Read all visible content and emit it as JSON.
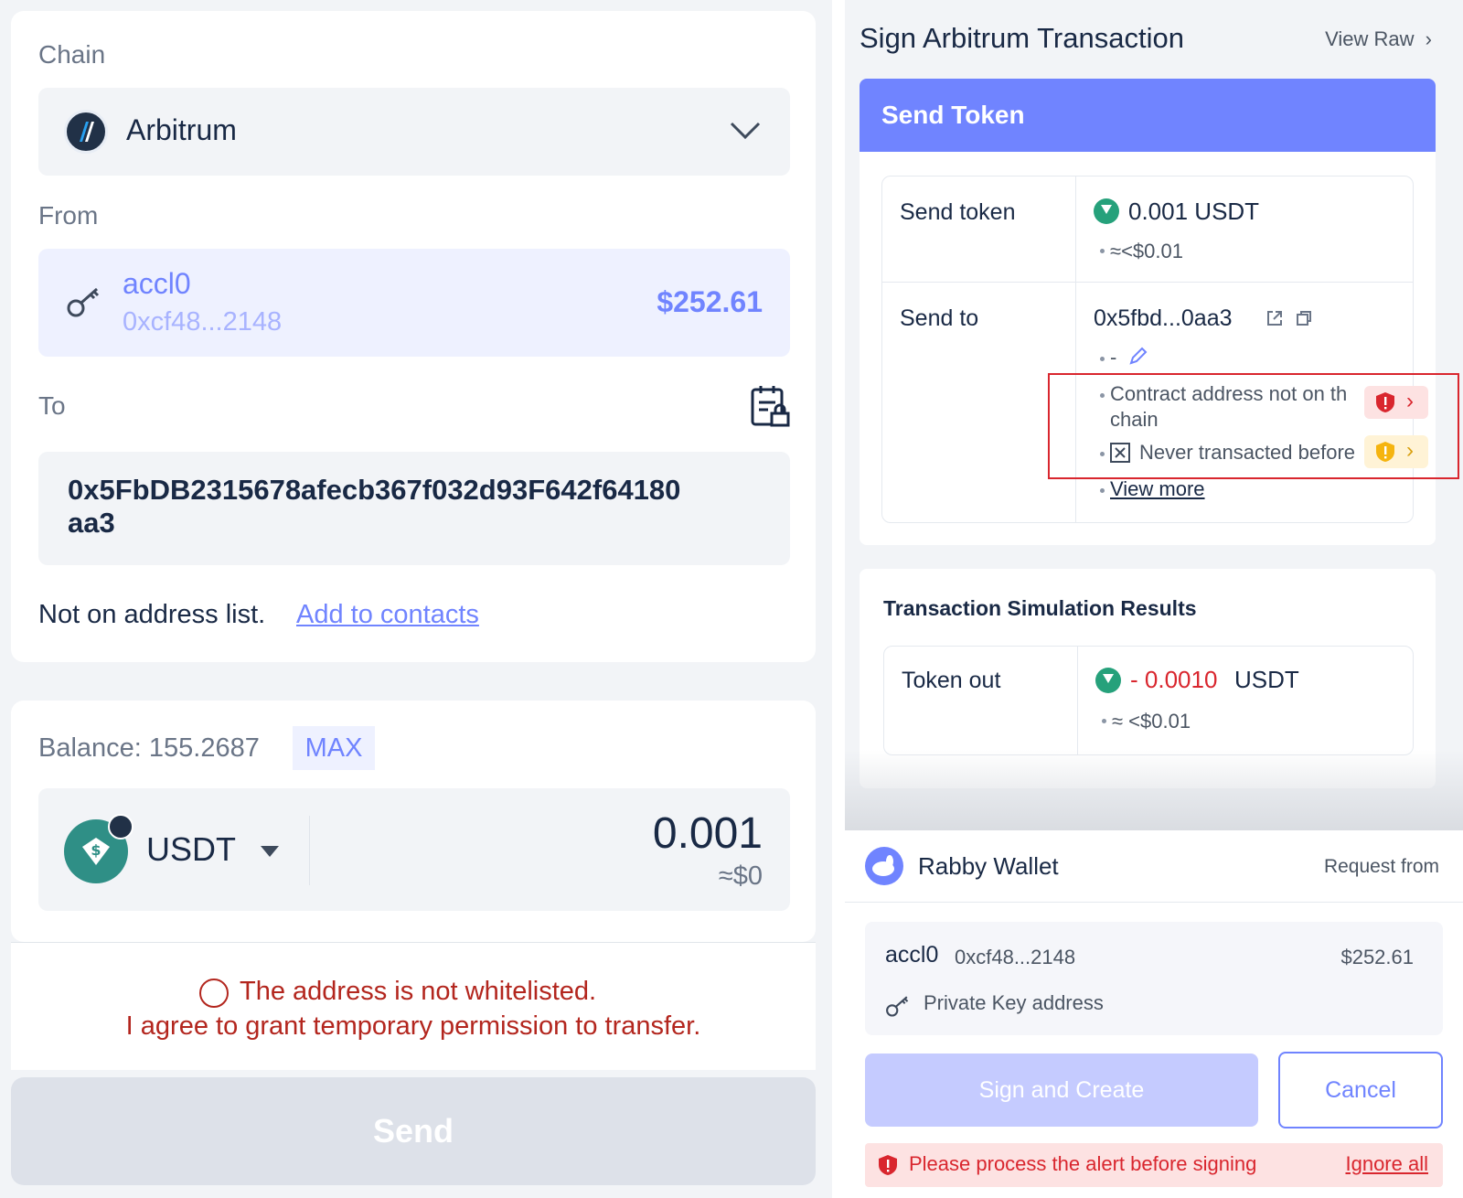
{
  "send_form": {
    "chain_label": "Chain",
    "chain_value": "Arbitrum",
    "from_label": "From",
    "from_account_name": "accl0",
    "from_account_address": "0xcf48...2148",
    "from_account_balance": "$252.61",
    "to_label": "To",
    "to_address_line1": "0x5FbDB2315678afecb367f032d93F642f64180",
    "to_address_line2": "aa3",
    "address_note": "Not on address list.",
    "add_contacts_link": "Add to contacts",
    "balance_text": "Balance: 155.2687",
    "max_label": "MAX",
    "token_symbol": "USDT",
    "amount": "0.001",
    "amount_usd": "≈$0",
    "whitelist_warning_line1": "The address is not whitelisted.",
    "whitelist_warning_line2": "I agree to grant temporary permission to transfer.",
    "send_button": "Send"
  },
  "sign_panel": {
    "title": "Sign Arbitrum Transaction",
    "view_raw": "View Raw",
    "action_header": "Send Token",
    "send_token_label": "Send token",
    "send_token_amount": "0.001 USDT",
    "send_token_usd": "≈<$0.01",
    "send_to_label": "Send to",
    "send_to_address": "0x5fbd...0aa3",
    "send_to_alias": "-",
    "alert_contract_line1": "Contract address not on th",
    "alert_contract_line2": "chain",
    "alert_never_transacted": "Never transacted before",
    "view_more": "View more",
    "simulation_title": "Transaction Simulation Results",
    "token_out_label": "Token out",
    "token_out_amount": "- 0.0010",
    "token_out_symbol": "USDT",
    "token_out_usd": "≈ <$0.01",
    "wallet_name": "Rabby Wallet",
    "request_from": "Request from",
    "account_name": "accl0",
    "account_address": "0xcf48...2148",
    "account_balance": "$252.61",
    "account_type": "Private Key address",
    "sign_button": "Sign and Create",
    "cancel_button": "Cancel",
    "alert_bar_text": "Please process the alert before signing",
    "ignore_all": "Ignore all"
  },
  "colors": {
    "accent": "#7084ff",
    "danger": "#b3261e",
    "warning": "#f5b40f",
    "usdt": "#26a17b",
    "highlight_box": "#d9262e"
  }
}
